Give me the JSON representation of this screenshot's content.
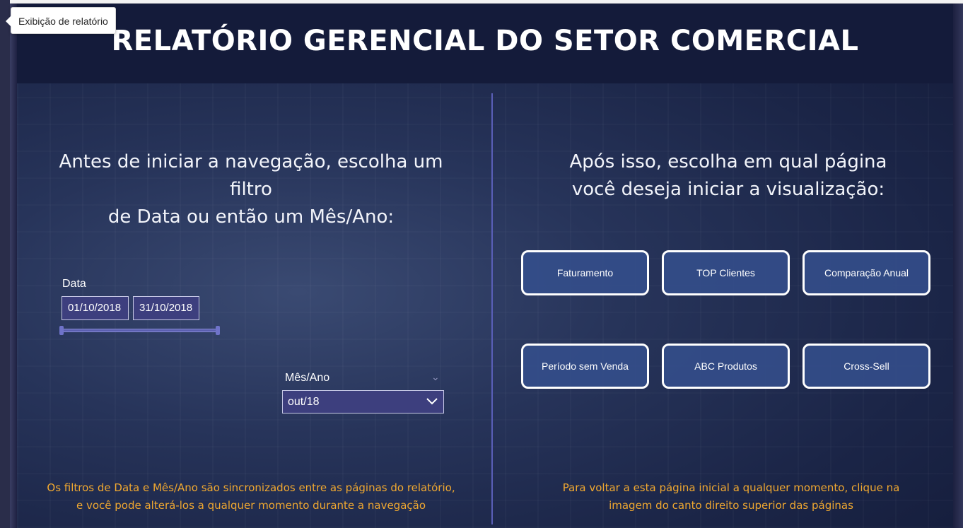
{
  "tooltip": {
    "text": "Exibição de relatório"
  },
  "header": {
    "title": "RELATÓRIO GERENCIAL DO SETOR COMERCIAL"
  },
  "left_panel": {
    "prompt_line1": "Antes de iniciar a navegação, escolha um filtro",
    "prompt_line2": "de Data ou então um Mês/Ano:",
    "date_filter": {
      "label": "Data",
      "start": "01/10/2018",
      "end": "31/10/2018"
    },
    "month_filter": {
      "label": "Mês/Ano",
      "selected": "out/18"
    },
    "note_line1": "Os filtros de Data e Mês/Ano são sincronizados entre as páginas do relatório,",
    "note_line2": "e você pode alterá-los a qualquer momento durante a navegação"
  },
  "right_panel": {
    "prompt_line1": "Após isso, escolha em qual página",
    "prompt_line2": "você deseja iniciar a visualização:",
    "buttons": [
      {
        "label": "Faturamento"
      },
      {
        "label": "TOP Clientes"
      },
      {
        "label": "Comparação Anual"
      },
      {
        "label": "Período sem Venda"
      },
      {
        "label": "ABC Produtos"
      },
      {
        "label": "Cross-Sell"
      }
    ],
    "note_line1": "Para voltar a esta página inicial a qualquer momento, clique na",
    "note_line2": "imagem do canto direito superior das páginas"
  },
  "colors": {
    "accent_note": "#f0a830",
    "button_fill": "#344e8c",
    "slicer_fill": "#3d3f7e",
    "divider": "#5a5fb8"
  },
  "icons": {
    "dropdown": "chevron-down-icon",
    "tooltip_pointer": "caret-left-icon"
  }
}
